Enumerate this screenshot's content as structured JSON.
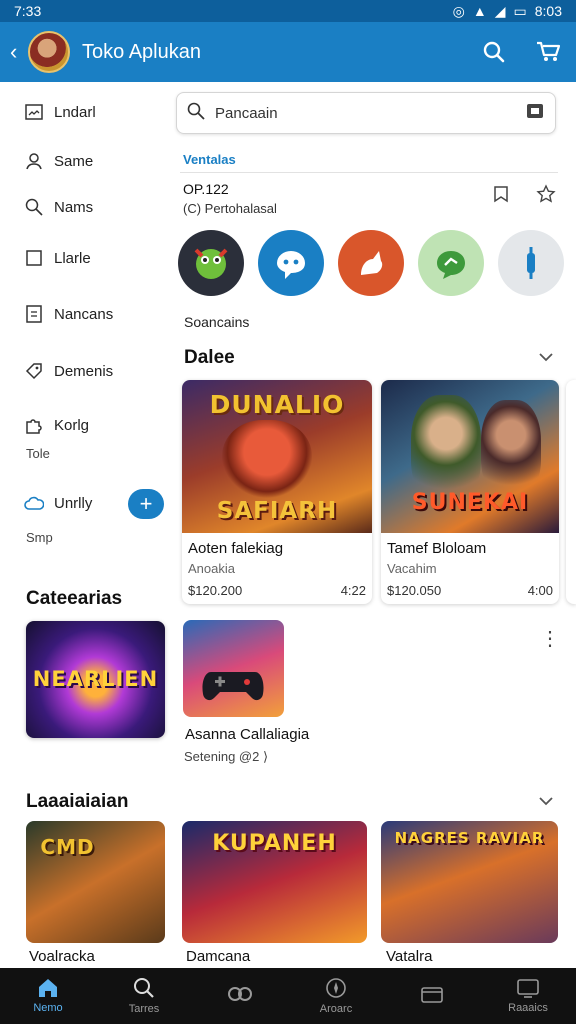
{
  "status": {
    "time": "7:33",
    "right_time": "8:03"
  },
  "appbar": {
    "title": "Toko Aplukan"
  },
  "sidebar": {
    "items": [
      {
        "label": "Lndarl"
      },
      {
        "label": "Same"
      },
      {
        "label": "Nams"
      },
      {
        "label": "Llarle"
      },
      {
        "label": "Nancans"
      },
      {
        "label": "Demenis"
      },
      {
        "label": "Korlg",
        "sub": "Tole"
      },
      {
        "label": "Unrlly",
        "sub": "Smp"
      }
    ],
    "fab_label": "+"
  },
  "search": {
    "placeholder": "Pancaain"
  },
  "tabs": {
    "active": "Ventalas"
  },
  "info": {
    "line1": "OP.122",
    "line2": "(C) Pertohalasal"
  },
  "circles_label": "Soancains",
  "section_dale": {
    "title": "Dalee"
  },
  "games": [
    {
      "name": "Aoten falekiag",
      "sub": "Anoakia",
      "price": "$120.200",
      "rating": "4:22",
      "art1": "DUNALIO",
      "art2": "SAFIARH"
    },
    {
      "name": "Tamef Bloloam",
      "sub": "Vacahim",
      "price": "$120.050",
      "rating": "4:00",
      "art2": "SUNEKAI"
    }
  ],
  "categories": {
    "title": "Cateearias",
    "banner_text": "NEARLIEN",
    "item_title": "Asanna Callaliagia",
    "item_sub": "Setening @2 ⟩"
  },
  "section_bottom": {
    "title": "Laaaiaiaian",
    "items": [
      {
        "name": "Voalracka",
        "art": "CMD"
      },
      {
        "name": "Damcana",
        "art": "KUPANEH"
      },
      {
        "name": "Vatalra",
        "art": "NAGRES RAVIAR"
      }
    ]
  },
  "bottomnav": [
    {
      "label": "Nemo",
      "icon": "home-icon"
    },
    {
      "label": "Tarres",
      "icon": "search-icon"
    },
    {
      "label": "",
      "icon": "link-icon"
    },
    {
      "label": "Aroarc",
      "icon": "compass-icon"
    },
    {
      "label": "",
      "icon": "folder-icon"
    },
    {
      "label": "Raaaics",
      "icon": "screen-icon"
    }
  ],
  "colors": {
    "primary": "#1a7fc4",
    "statusbar": "#0d5f9c",
    "nav_bg": "#111111",
    "active_nav": "#5bb2f0"
  }
}
